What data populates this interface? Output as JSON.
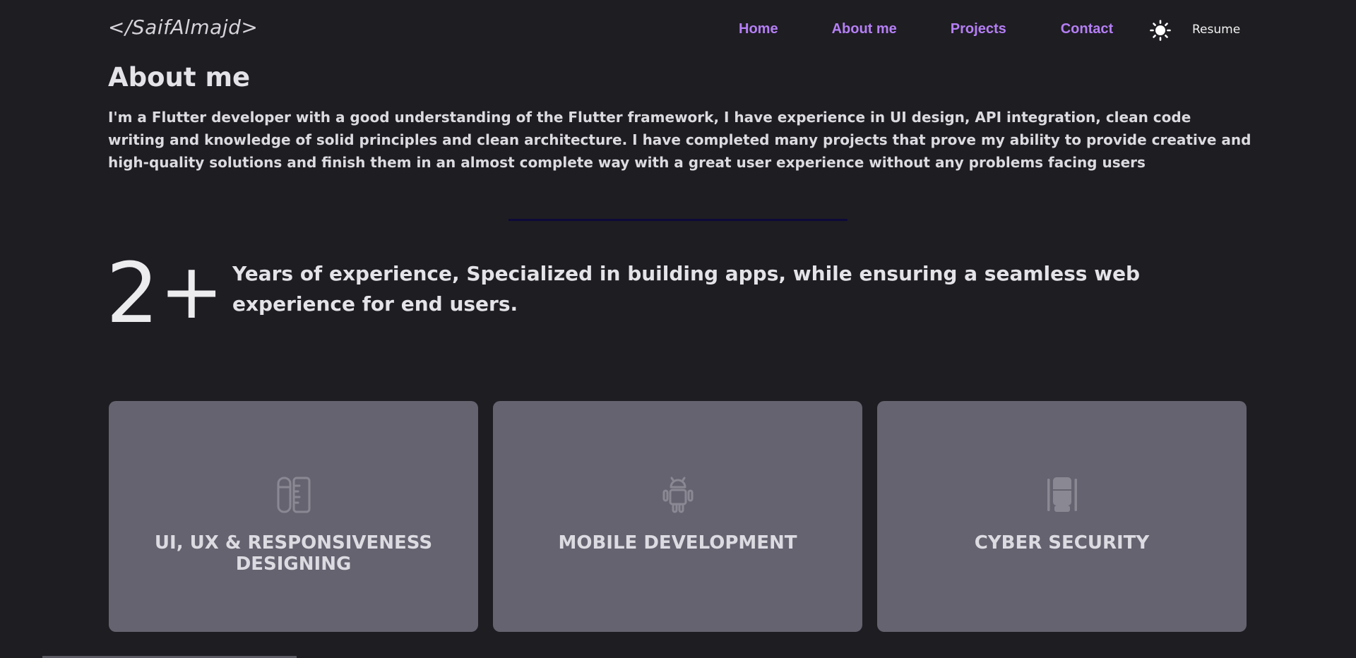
{
  "header": {
    "brand": "</SaifAlmajd>",
    "nav": {
      "home": "Home",
      "about": "About me",
      "projects": "Projects",
      "contact": "Contact"
    },
    "theme_icon": "sun-icon",
    "resume": "Resume"
  },
  "about": {
    "title": "About me",
    "description": "I'm a Flutter developer with a good understanding of the Flutter framework, I have experience in UI design, API integration, clean code writing and knowledge of solid principles and clean architecture. I have completed many projects that prove my ability to provide creative and high-quality solutions and finish them in an almost complete way with a great user experience without any problems facing users"
  },
  "experience": {
    "years": "2",
    "plus": "+",
    "text": "Years of experience, Specialized in building apps, while ensuring a seamless web experience for end users."
  },
  "services": [
    {
      "icon": "ruler-pencil-icon",
      "title": "UI, UX & RESPONSIVENESS DESIGNING"
    },
    {
      "icon": "android-icon",
      "title": "MOBILE DEVELOPMENT"
    },
    {
      "icon": "security-chair-icon",
      "title": "CYBER SECURITY"
    }
  ],
  "colors": {
    "background": "#1e1d22",
    "nav_accent": "#b57ff5",
    "card": "#65636f",
    "divider": "#0d0a3a"
  }
}
